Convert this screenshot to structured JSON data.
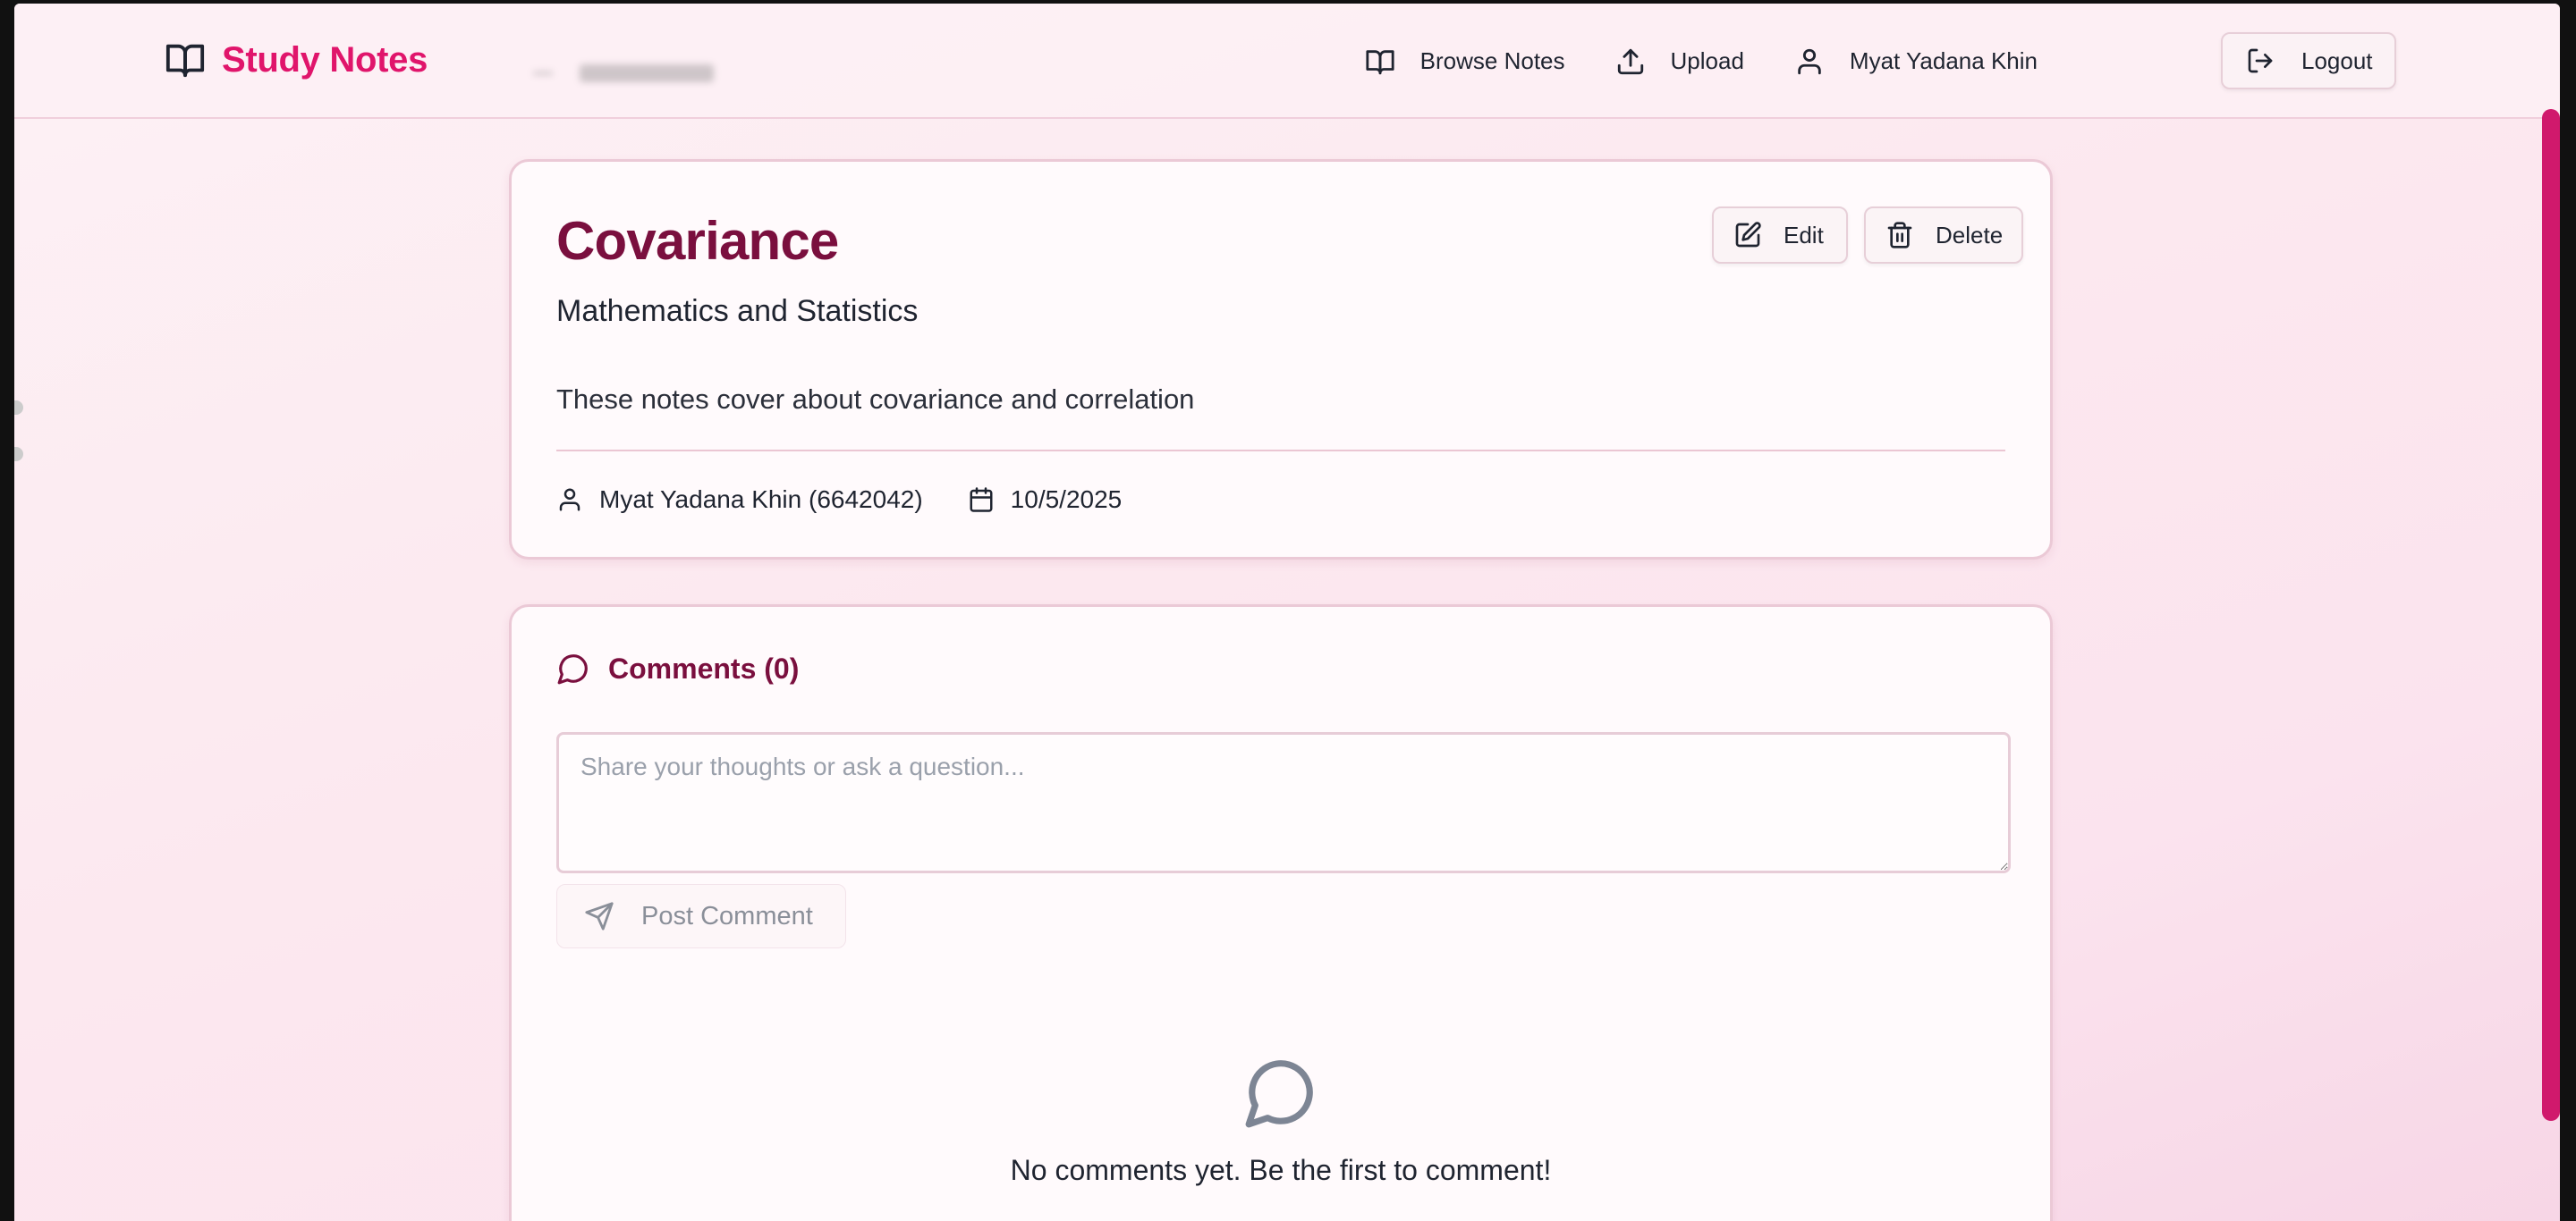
{
  "brand": {
    "name": "Study Notes",
    "icon": "book-open-icon",
    "color": "#e0156b"
  },
  "nav": {
    "browse_label": "Browse Notes",
    "upload_label": "Upload",
    "user_name": "Myat Yadana Khin",
    "logout_label": "Logout"
  },
  "note": {
    "title": "Covariance",
    "subject": "Mathematics and Statistics",
    "description": "These notes cover about covariance and correlation",
    "author": "Myat Yadana Khin (6642042)",
    "date": "10/5/2025",
    "edit_label": "Edit",
    "delete_label": "Delete"
  },
  "comments": {
    "title": "Comments (0)",
    "placeholder": "Share your thoughts or ask a question...",
    "post_label": "Post Comment",
    "empty_text": "No comments yet. Be the first to comment!"
  },
  "colors": {
    "accent": "#e0156b",
    "title": "#7a0f3e",
    "scrollbar": "#d0196c"
  }
}
